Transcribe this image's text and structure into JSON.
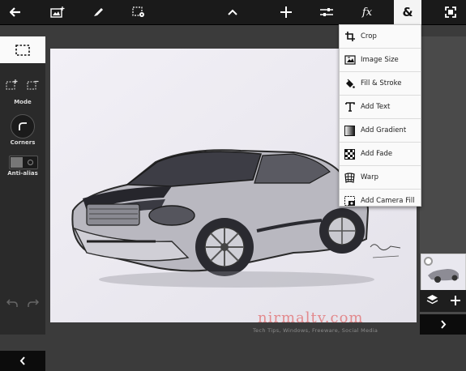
{
  "toolbar": {
    "tools": [
      "back-arrow",
      "add-image",
      "brush",
      "selection-settings",
      "collapse",
      "move",
      "adjustments",
      "fx",
      "ampersand",
      "fit-screen"
    ],
    "fx_label": "fx",
    "amp_label": "&"
  },
  "left_panel": {
    "mode_label": "Mode",
    "corners_label": "Corners",
    "antialias_label": "Anti-alias"
  },
  "menu": {
    "items": [
      {
        "label": "Crop",
        "icon": "crop-icon"
      },
      {
        "label": "Image Size",
        "icon": "image-size-icon"
      },
      {
        "label": "Fill & Stroke",
        "icon": "fill-bucket-icon"
      },
      {
        "label": "Add Text",
        "icon": "text-icon"
      },
      {
        "label": "Add Gradient",
        "icon": "gradient-icon"
      },
      {
        "label": "Add Fade",
        "icon": "fade-icon"
      },
      {
        "label": "Warp",
        "icon": "warp-icon"
      },
      {
        "label": "Add Camera Fill",
        "icon": "camera-fill-icon"
      }
    ]
  },
  "watermark": {
    "text": "nirmaltv.com",
    "subtitle": "Tech Tips, Windows, Freeware, Social Media"
  },
  "colors": {
    "toolbar_bg": "#1a1a1a",
    "panel_bg": "#2a2a2a",
    "workspace_bg": "#3b3b3b",
    "menu_bg": "#fafafa",
    "active_tab": "#f4f4f4"
  }
}
